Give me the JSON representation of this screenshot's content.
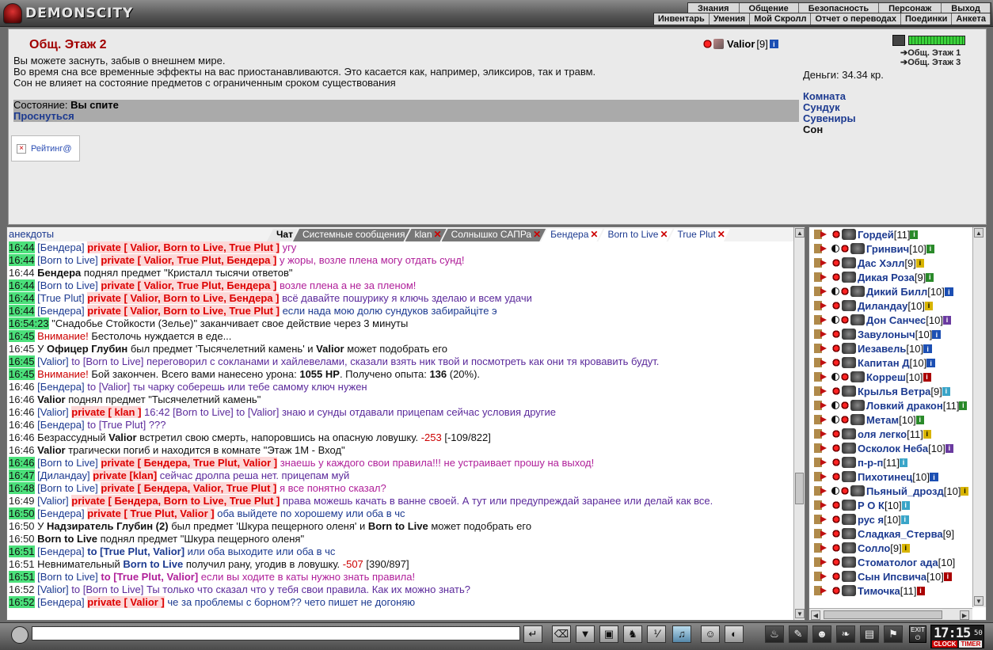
{
  "brand": {
    "name": "DEMONSCITY"
  },
  "nav": {
    "top": [
      "Знания",
      "Общение",
      "Безопасность",
      "Персонаж",
      "Выход"
    ],
    "sub": [
      "Инвентарь",
      "Умения",
      "Мой Скролл",
      "Отчет о переводах",
      "Поединки",
      "Анкета"
    ]
  },
  "room": {
    "title": "Общ. Этаж 2",
    "user": {
      "name": "Valior",
      "level": "[9]"
    },
    "description": [
      "Вы можете заснуть, забыв о внешнем мире.",
      "Во время сна все временные эффекты на вас приостанавливаются. Это касается как, например, эликсиров, так и травм.",
      "Сон не влияет на состояние предметов с ограниченным сроком существования"
    ],
    "state_label": "Состояние:",
    "state_value": "Вы спите",
    "wake_label": "Проснуться",
    "rating_label": "Рейтинг@",
    "floors": [
      "Общ. Этаж 1",
      "Общ. Этаж 3"
    ],
    "money": "Деньги: 34.34 кр.",
    "menu": [
      "Комната",
      "Сундук",
      "Сувениры"
    ],
    "menu_current": "Сон"
  },
  "chat": {
    "header_link": "анекдоты",
    "tabs": [
      {
        "label": "Чат",
        "style": "act"
      },
      {
        "label": "Системные сообщения",
        "style": "dark"
      },
      {
        "label": "klan",
        "style": "dark",
        "close": "✕"
      },
      {
        "label": "Солнышко САПРа",
        "style": "dark",
        "close": "✕"
      },
      {
        "label": "Бендера",
        "style": "blue",
        "close": "✕"
      },
      {
        "label": "Born to Live",
        "style": "blue",
        "close": "✕"
      },
      {
        "label": "True Plut",
        "style": "blue",
        "close": "✕"
      }
    ],
    "messages": [
      {
        "time": "16:44",
        "hl": true,
        "parts": [
          [
            "nm",
            "[Бендера] "
          ],
          [
            "pv",
            "private [ Valior, Born to Live, True Plut ]"
          ],
          [
            "pk",
            " угу"
          ]
        ]
      },
      {
        "time": "16:44",
        "hl": true,
        "parts": [
          [
            "nm",
            "[Born to Live] "
          ],
          [
            "pv",
            "private [ Valior, True Plut, Бендера ]"
          ],
          [
            "pk",
            " у жоры, возле плена могу отдать сунд!"
          ]
        ]
      },
      {
        "time": "16:44",
        "hl": false,
        "parts": [
          [
            "b",
            "Бендера"
          ],
          [
            "t",
            " поднял предмет \"Кристалл тысячи ответов\""
          ]
        ]
      },
      {
        "time": "16:44",
        "hl": true,
        "parts": [
          [
            "nm",
            "[Born to Live] "
          ],
          [
            "pv",
            "private [ Valior, True Plut, Бендера ]"
          ],
          [
            "pk",
            " возле плена а не за пленом!"
          ]
        ]
      },
      {
        "time": "16:44",
        "hl": true,
        "parts": [
          [
            "nm",
            "[True Plut] "
          ],
          [
            "pv",
            "private [ Valior, Born to Live, Бендера ]"
          ],
          [
            "pu",
            " всё давайте пошурику я ключь зделаю и всем удачи"
          ]
        ]
      },
      {
        "time": "16:44",
        "hl": true,
        "parts": [
          [
            "nm",
            "[Бендера] "
          ],
          [
            "pv",
            "private [ Valior, Born to Live, True Plut ]"
          ],
          [
            "bl",
            " если нада мою долю сундуков забирайціте э"
          ]
        ]
      },
      {
        "time": "16:54:23",
        "hl": true,
        "parts": [
          [
            "t",
            " \"Снадобье Стойкости (Зелье)\" заканчивает свое действие через 3 минуты"
          ]
        ]
      },
      {
        "time": "16:45",
        "hl": true,
        "parts": [
          [
            "rd",
            "Внимание!"
          ],
          [
            "t",
            " Бестолочь нуждается в еде..."
          ]
        ]
      },
      {
        "time": "16:45",
        "hl": false,
        "parts": [
          [
            "t",
            "У "
          ],
          [
            "b",
            "Офицер Глубин"
          ],
          [
            "t",
            " был предмет 'Тысячелетний камень' и "
          ],
          [
            "b",
            "Valior"
          ],
          [
            "t",
            " может подобрать его"
          ]
        ]
      },
      {
        "time": "16:45",
        "hl": true,
        "parts": [
          [
            "nm",
            "[Valior]"
          ],
          [
            "pu",
            " to [Born to Live] переговорил с сокланами и хайлевелами, сказали взять ник твой и посмотреть как они тя кровавить будут."
          ]
        ]
      },
      {
        "time": "16:45",
        "hl": true,
        "parts": [
          [
            "rd",
            "Внимание!"
          ],
          [
            "t",
            " Бой закончен. Всего вами нанесено урона: "
          ],
          [
            "b",
            "1055 HP"
          ],
          [
            "t",
            ". Получено опыта: "
          ],
          [
            "b",
            "136"
          ],
          [
            "t",
            " (20%)."
          ]
        ]
      },
      {
        "time": "16:46",
        "hl": false,
        "parts": [
          [
            "nm",
            "[Бендера]"
          ],
          [
            "pu",
            " to [Valior] ты чарку соберешь или тебе самому ключ нужен"
          ]
        ]
      },
      {
        "time": "16:46",
        "hl": false,
        "parts": [
          [
            "b",
            "Valior"
          ],
          [
            "t",
            " поднял предмет \"Тысячелетний камень\""
          ]
        ]
      },
      {
        "time": "16:46",
        "hl": false,
        "parts": [
          [
            "nm",
            "[Valior] "
          ],
          [
            "pv",
            "private [ klan ]"
          ],
          [
            "pu",
            " 16:42 [Born to Live] to [Valior] знаю и сунды отдавали прицепам сейчас условия другие"
          ]
        ]
      },
      {
        "time": "16:46",
        "hl": false,
        "parts": [
          [
            "nm",
            "[Бендера]"
          ],
          [
            "pu",
            " to [True Plut] ???"
          ]
        ]
      },
      {
        "time": "16:46",
        "hl": false,
        "parts": [
          [
            "t",
            "Безрассудный "
          ],
          [
            "b",
            "Valior"
          ],
          [
            "t",
            " встретил свою смерть, напоровшись на опасную ловушку. "
          ],
          [
            "rd",
            "-253"
          ],
          [
            "t",
            " [-109/822]"
          ]
        ]
      },
      {
        "time": "16:46",
        "hl": false,
        "parts": [
          [
            "b",
            "Valior"
          ],
          [
            "t",
            " трагически погиб и находится в комнате \"Этаж 1М - Вход\""
          ]
        ]
      },
      {
        "time": "16:46",
        "hl": true,
        "parts": [
          [
            "nm",
            "[Born to Live] "
          ],
          [
            "pv",
            "private [ Бендера, True Plut, Valior ]"
          ],
          [
            "pk",
            " знаешь у каждого свои правила!!! не устраивает прошу на выход!"
          ]
        ]
      },
      {
        "time": "16:47",
        "hl": true,
        "parts": [
          [
            "nm",
            "[Диландау] "
          ],
          [
            "pv",
            "private [klan]"
          ],
          [
            "pu",
            " сейчас дролпа реша нет. прицепам муй"
          ]
        ]
      },
      {
        "time": "16:48",
        "hl": true,
        "parts": [
          [
            "nm",
            "[Born to Live] "
          ],
          [
            "pv",
            "private [ Бендера, Valior, True Plut ]"
          ],
          [
            "pk",
            " я все понятно сказал?"
          ]
        ]
      },
      {
        "time": "16:49",
        "hl": false,
        "wrap": true,
        "parts": [
          [
            "nm",
            "[Valior] "
          ],
          [
            "pv",
            "private [ Бендера, Born to Live, True Plut ]"
          ],
          [
            "pu",
            " права можешь качать в ванне своей. А тут или предупреждай заранее или делай как все."
          ]
        ]
      },
      {
        "time": "16:50",
        "hl": true,
        "parts": [
          [
            "nm",
            "[Бендера] "
          ],
          [
            "pv",
            "private [ True Plut, Valior ]"
          ],
          [
            "bl",
            " оба выйдете по хорошему или оба в чс"
          ]
        ]
      },
      {
        "time": "16:50",
        "hl": false,
        "parts": [
          [
            "t",
            "У "
          ],
          [
            "b",
            "Надзиратель Глубин (2)"
          ],
          [
            "t",
            " был предмет 'Шкура пещерного оленя' и "
          ],
          [
            "b",
            "Born to Live"
          ],
          [
            "t",
            " может подобрать его"
          ]
        ]
      },
      {
        "time": "16:50",
        "hl": false,
        "parts": [
          [
            "b",
            "Born to Live"
          ],
          [
            "t",
            " поднял предмет \"Шкура пещерного оленя\""
          ]
        ]
      },
      {
        "time": "16:51",
        "hl": true,
        "parts": [
          [
            "nm",
            "[Бендера] "
          ],
          [
            "bb",
            "to [True Plut, Valior]"
          ],
          [
            "bl",
            " или оба выходите или оба в чс"
          ]
        ]
      },
      {
        "time": "16:51",
        "hl": false,
        "parts": [
          [
            "t",
            "Невнимательный "
          ],
          [
            "b2",
            "Born to Live"
          ],
          [
            "t",
            " получил рану, угодив в ловушку. "
          ],
          [
            "rd",
            "-507"
          ],
          [
            "t",
            " [390/897]"
          ]
        ]
      },
      {
        "time": "16:51",
        "hl": true,
        "parts": [
          [
            "nm",
            "[Born to Live] "
          ],
          [
            "pkb",
            "to [True Plut, Valior]"
          ],
          [
            "pk",
            " если вы ходите в каты нужно знать правила!"
          ]
        ]
      },
      {
        "time": "16:52",
        "hl": false,
        "parts": [
          [
            "nm",
            "[Valior]"
          ],
          [
            "pu",
            " to [Born to Live] Ты только что сказал что у тебя свои правила. Как их можно знать?"
          ]
        ]
      },
      {
        "time": "16:52",
        "hl": true,
        "parts": [
          [
            "nm",
            "[Бендера] "
          ],
          [
            "pv",
            "private [ Valior ]"
          ],
          [
            "bl",
            " че за проблемы с борном?? чето пишет не догоняю"
          ]
        ]
      }
    ]
  },
  "users": [
    {
      "name": "Гордей",
      "lvl": "[11]",
      "c": "g",
      "d": false
    },
    {
      "name": "Гринвич",
      "lvl": "[10]",
      "c": "g",
      "d": true
    },
    {
      "name": "Дас Хэлл",
      "lvl": "[9]",
      "c": "y",
      "d": false
    },
    {
      "name": "Дикая Роза",
      "lvl": "[9]",
      "c": "g",
      "d": false
    },
    {
      "name": "Дикий Билл",
      "lvl": "[10]",
      "c": "b",
      "d": true
    },
    {
      "name": "Диландау",
      "lvl": "[10]",
      "c": "y",
      "d": false
    },
    {
      "name": "Дон Санчес",
      "lvl": "[10]",
      "c": "p",
      "d": true
    },
    {
      "name": "Завулоныч",
      "lvl": "[10]",
      "c": "b",
      "d": false
    },
    {
      "name": "Иезавель",
      "lvl": "[10]",
      "c": "b",
      "d": false
    },
    {
      "name": "Капитан Д",
      "lvl": "[10]",
      "c": "b",
      "d": false
    },
    {
      "name": "Корреш",
      "lvl": "[10]",
      "c": "r",
      "d": true
    },
    {
      "name": "Крылья Ветра",
      "lvl": "[9]",
      "c": "c",
      "d": false
    },
    {
      "name": "Ловкий дракон",
      "lvl": "[11]",
      "c": "g",
      "d": true
    },
    {
      "name": "Метам",
      "lvl": "[10]",
      "c": "g",
      "d": true
    },
    {
      "name": "оля легко",
      "lvl": "[11]",
      "c": "y",
      "d": false
    },
    {
      "name": "Осколок Неба",
      "lvl": "[10]",
      "c": "p",
      "d": false
    },
    {
      "name": "п-р-п",
      "lvl": "[11]",
      "c": "c",
      "d": false
    },
    {
      "name": "Пихотинец",
      "lvl": "[10]",
      "c": "b",
      "d": false
    },
    {
      "name": "Пьяный_дрозд",
      "lvl": "[10]",
      "c": "y",
      "d": true
    },
    {
      "name": "Р О К",
      "lvl": "[10]",
      "c": "c",
      "d": false
    },
    {
      "name": "рус я",
      "lvl": "[10]",
      "c": "c",
      "d": false
    },
    {
      "name": "Сладкая_Стерва",
      "lvl": "[9]",
      "c": "",
      "d": false
    },
    {
      "name": "Солло",
      "lvl": "[9]",
      "c": "y",
      "d": false
    },
    {
      "name": "Стоматолог ада",
      "lvl": "[10]",
      "c": "",
      "d": false
    },
    {
      "name": "Сын Ипсвича",
      "lvl": "[10]",
      "c": "r",
      "d": false
    },
    {
      "name": "Тимочка",
      "lvl": "[11]",
      "c": "r",
      "d": false
    }
  ],
  "clock": {
    "time": "17:15",
    "sec": "50",
    "label1": "CLOCK",
    "label2": "TIMER"
  },
  "exit_label": "EXIT"
}
